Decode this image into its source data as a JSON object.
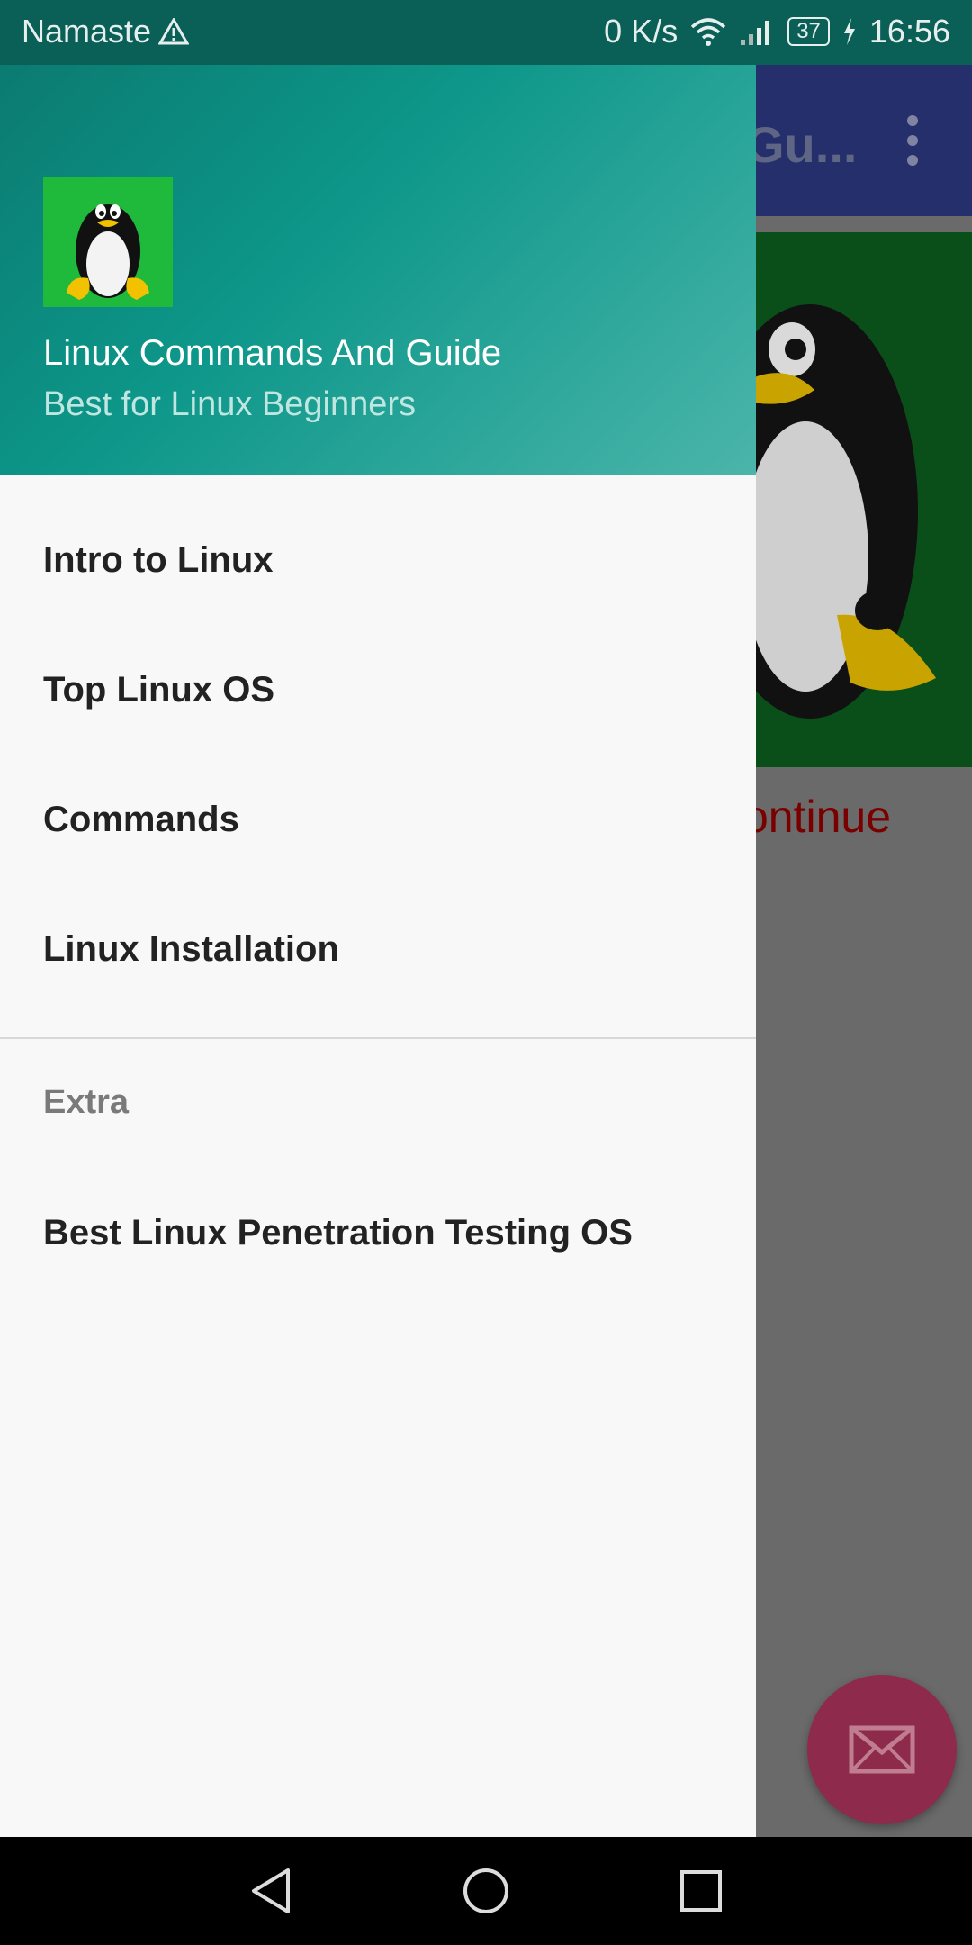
{
  "status_bar": {
    "carrier": "Namaste",
    "net_speed": "0 K/s",
    "battery": "37",
    "time": "16:56"
  },
  "app": {
    "title_fragment": "Gu...",
    "continue_fragment": "ontinue"
  },
  "drawer": {
    "title": "Linux Commands And Guide",
    "subtitle": "Best for Linux Beginners",
    "menu_items": [
      "Intro to Linux",
      "Top Linux OS",
      "Commands",
      "Linux Installation"
    ],
    "section_header": "Extra",
    "extra_items": [
      "Best Linux Penetration Testing OS"
    ]
  },
  "colors": {
    "drawer_header": "#0d978a",
    "toolbar": "#252f6b",
    "fab": "#8e2a4c",
    "logo_bg": "#1fb93b"
  }
}
